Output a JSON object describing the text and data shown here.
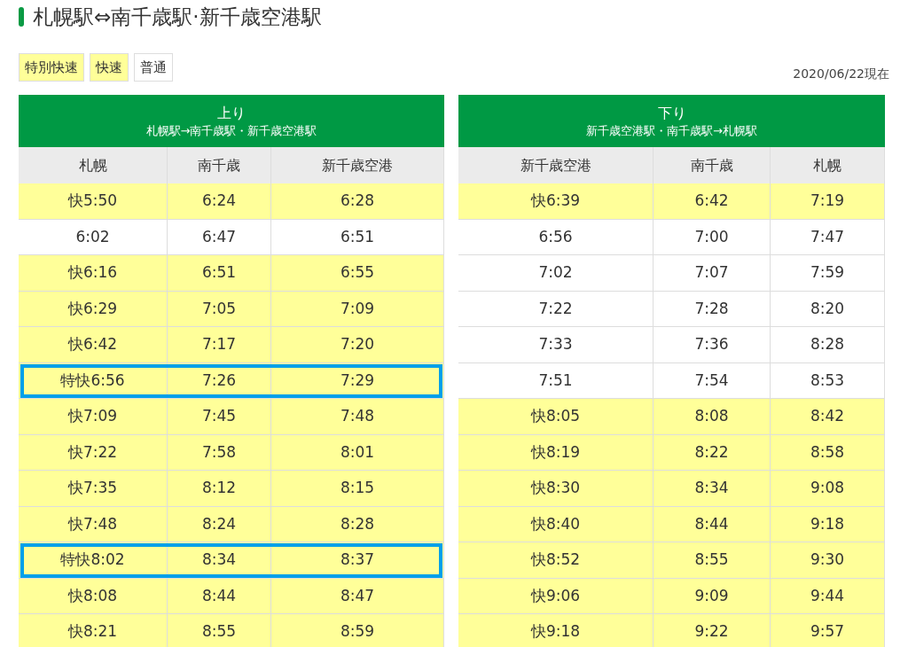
{
  "title": "札幌駅⇔南千歳駅·新千歳空港駅",
  "legend": [
    {
      "label": "特別快速",
      "kind": "rapid"
    },
    {
      "label": "快速",
      "kind": "rapid"
    },
    {
      "label": "普通",
      "kind": "local"
    }
  ],
  "as_of": "2020/06/22現在",
  "tables": [
    {
      "direction": "上り",
      "route": "札幌駅→南千歳駅・新千歳空港駅",
      "columns": [
        "札幌",
        "南千歳",
        "新千歳空港"
      ],
      "rows": [
        {
          "kind": "rapid",
          "highlighted": false,
          "cells": [
            "快5:50",
            "6:24",
            "6:28"
          ]
        },
        {
          "kind": "local",
          "highlighted": false,
          "cells": [
            "6:02",
            "6:47",
            "6:51"
          ]
        },
        {
          "kind": "rapid",
          "highlighted": false,
          "cells": [
            "快6:16",
            "6:51",
            "6:55"
          ]
        },
        {
          "kind": "rapid",
          "highlighted": false,
          "cells": [
            "快6:29",
            "7:05",
            "7:09"
          ]
        },
        {
          "kind": "rapid",
          "highlighted": false,
          "cells": [
            "快6:42",
            "7:17",
            "7:20"
          ]
        },
        {
          "kind": "rapid",
          "highlighted": true,
          "cells": [
            "特快6:56",
            "7:26",
            "7:29"
          ]
        },
        {
          "kind": "rapid",
          "highlighted": false,
          "cells": [
            "快7:09",
            "7:45",
            "7:48"
          ]
        },
        {
          "kind": "rapid",
          "highlighted": false,
          "cells": [
            "快7:22",
            "7:58",
            "8:01"
          ]
        },
        {
          "kind": "rapid",
          "highlighted": false,
          "cells": [
            "快7:35",
            "8:12",
            "8:15"
          ]
        },
        {
          "kind": "rapid",
          "highlighted": false,
          "cells": [
            "快7:48",
            "8:24",
            "8:28"
          ]
        },
        {
          "kind": "rapid",
          "highlighted": true,
          "cells": [
            "特快8:02",
            "8:34",
            "8:37"
          ]
        },
        {
          "kind": "rapid",
          "highlighted": false,
          "cells": [
            "快8:08",
            "8:44",
            "8:47"
          ]
        },
        {
          "kind": "rapid",
          "highlighted": false,
          "cells": [
            "快8:21",
            "8:55",
            "8:59"
          ]
        }
      ]
    },
    {
      "direction": "下り",
      "route": "新千歳空港駅・南千歳駅→札幌駅",
      "columns": [
        "新千歳空港",
        "南千歳",
        "札幌"
      ],
      "rows": [
        {
          "kind": "rapid",
          "highlighted": false,
          "cells": [
            "快6:39",
            "6:42",
            "7:19"
          ]
        },
        {
          "kind": "local",
          "highlighted": false,
          "cells": [
            "6:56",
            "7:00",
            "7:47"
          ]
        },
        {
          "kind": "local",
          "highlighted": false,
          "cells": [
            "7:02",
            "7:07",
            "7:59"
          ]
        },
        {
          "kind": "local",
          "highlighted": false,
          "cells": [
            "7:22",
            "7:28",
            "8:20"
          ]
        },
        {
          "kind": "local",
          "highlighted": false,
          "cells": [
            "7:33",
            "7:36",
            "8:28"
          ]
        },
        {
          "kind": "local",
          "highlighted": false,
          "cells": [
            "7:51",
            "7:54",
            "8:53"
          ]
        },
        {
          "kind": "rapid",
          "highlighted": false,
          "cells": [
            "快8:05",
            "8:08",
            "8:42"
          ]
        },
        {
          "kind": "rapid",
          "highlighted": false,
          "cells": [
            "快8:19",
            "8:22",
            "8:58"
          ]
        },
        {
          "kind": "rapid",
          "highlighted": false,
          "cells": [
            "快8:30",
            "8:34",
            "9:08"
          ]
        },
        {
          "kind": "rapid",
          "highlighted": false,
          "cells": [
            "快8:40",
            "8:44",
            "9:18"
          ]
        },
        {
          "kind": "rapid",
          "highlighted": false,
          "cells": [
            "快8:52",
            "8:55",
            "9:30"
          ]
        },
        {
          "kind": "rapid",
          "highlighted": false,
          "cells": [
            "快9:06",
            "9:09",
            "9:44"
          ]
        },
        {
          "kind": "rapid",
          "highlighted": false,
          "cells": [
            "快9:18",
            "9:22",
            "9:57"
          ]
        }
      ]
    }
  ]
}
